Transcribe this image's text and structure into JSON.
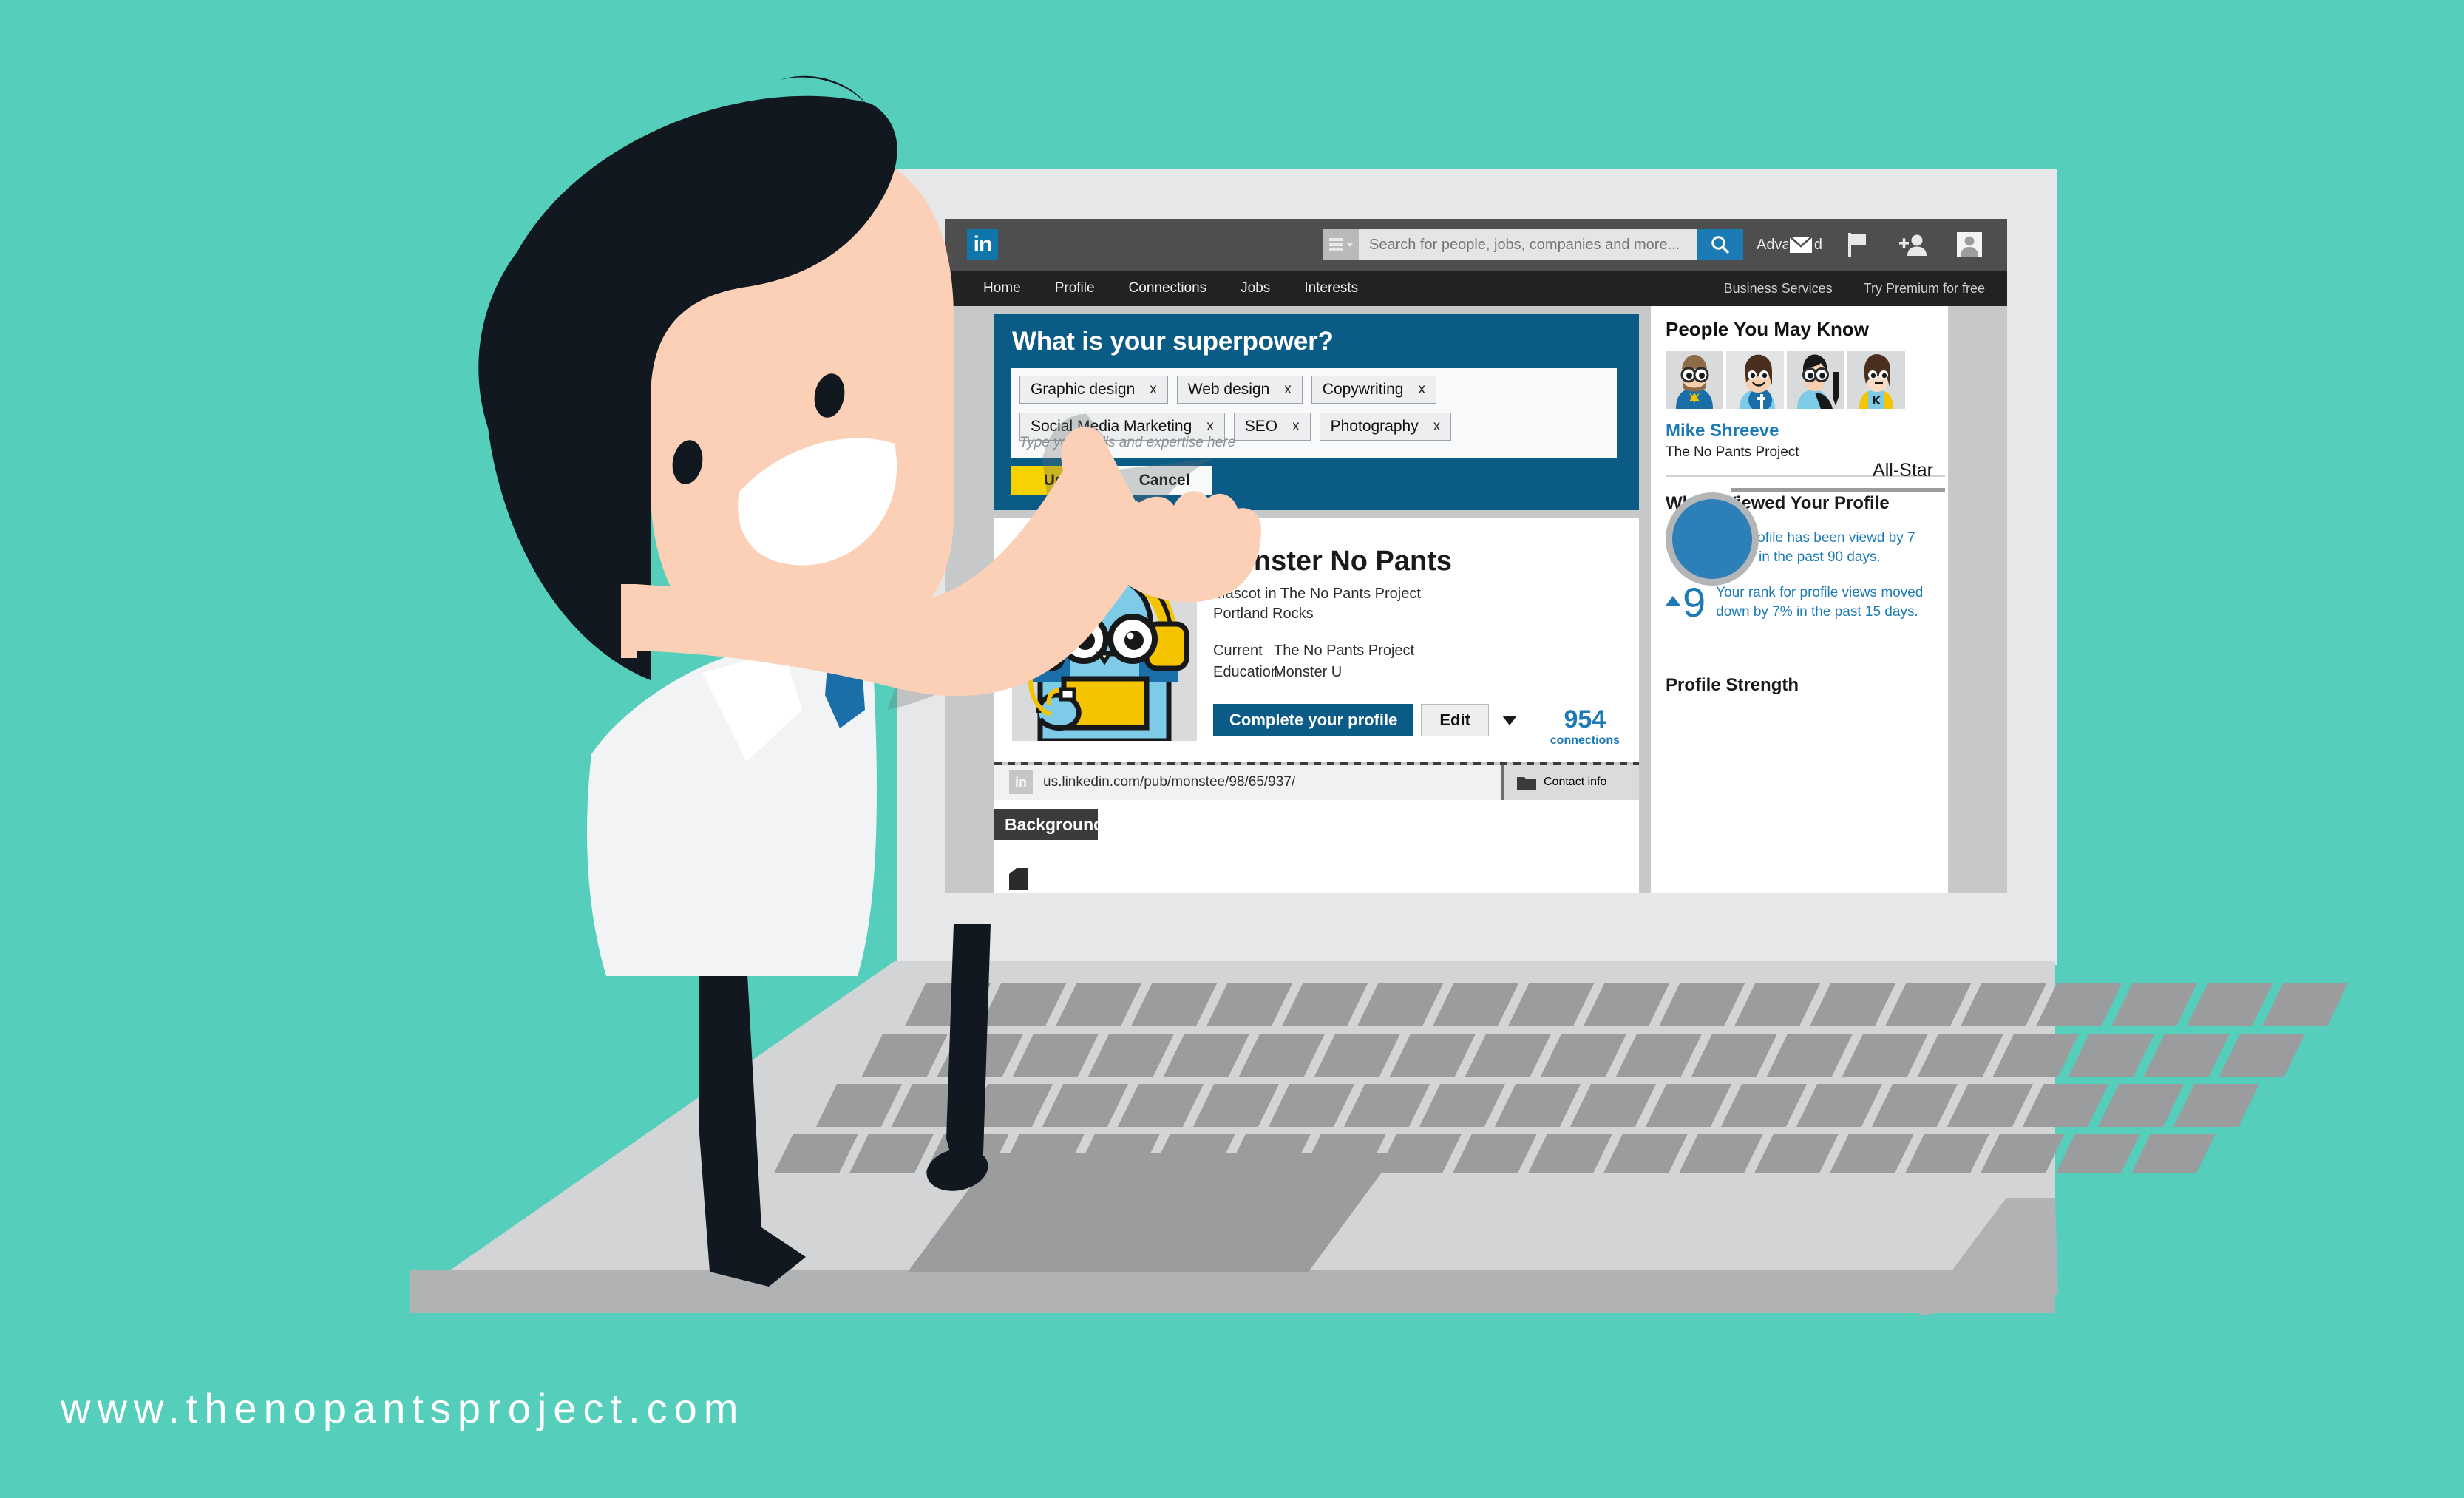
{
  "brand": {
    "teal": "#55cfbb",
    "linkedin_blue": "#0e76a8",
    "accent_blue": "#1c7ab5",
    "dialog_blue": "#0b5b87",
    "yellow": "#f5d200"
  },
  "footer": {
    "url": "www.thenopantsproject.com"
  },
  "topbar": {
    "logo_text": "in",
    "search_placeholder": "Search for people, jobs, companies and more...",
    "search_value": "",
    "search_icon": "magnifier-icon",
    "dropdown_icon": "hamburger-dropdown-icon",
    "advanced_label": "Advanced",
    "icons": [
      {
        "name": "messages-icon",
        "glyph": "envelope"
      },
      {
        "name": "notifications-icon",
        "glyph": "flag"
      },
      {
        "name": "add-connection-icon",
        "glyph": "person-plus"
      },
      {
        "name": "account-avatar-icon",
        "glyph": "avatar"
      }
    ]
  },
  "nav": {
    "primary": [
      "Home",
      "Profile",
      "Connections",
      "Jobs",
      "Interests"
    ],
    "secondary": [
      "Business Services",
      "Try Premium for free"
    ]
  },
  "superpower_dialog": {
    "title": "What is your superpower?",
    "placeholder": "Type your skills and expertise here",
    "input_value": "",
    "chips": [
      "Graphic design",
      "Web design",
      "Copywriting",
      "Social Media Marketing",
      "SEO",
      "Photography"
    ],
    "chip_remove_label": "x",
    "primary_button": "Use",
    "cancel_button": "Cancel"
  },
  "profile": {
    "name": "Monster No Pants",
    "headline": "Mascot in The No Pants Project",
    "location": "Portland Rocks",
    "meta": [
      {
        "key": "Current",
        "value": "The No Pants Project"
      },
      {
        "key": "Education",
        "value": "Monster U"
      }
    ],
    "complete_button": "Complete your profile",
    "edit_button": "Edit",
    "edit_caret_icon": "chevron-down-icon",
    "connections_count": "954",
    "connections_label": "connections",
    "public_url": "us.linkedin.com/pub/monstee/98/65/937/",
    "public_url_icon": "linkedin-small-icon",
    "contact_info_label": "Contact info",
    "contact_info_icon": "folder-icon",
    "background_tab": "Background"
  },
  "sidebar": {
    "pymk": {
      "title": "People You May Know",
      "thumbs": [
        "avatar-bearded-glasses",
        "avatar-woman-facebook",
        "avatar-man-pen",
        "avatar-woman-k"
      ],
      "person_name": "Mike Shreeve",
      "person_company": "The No Pants Project"
    },
    "who_viewed": {
      "title": "Who´s Viewed Your Profile",
      "stats": [
        {
          "number": "7",
          "arrow": false,
          "text": "Your profile has been viewd by 7 people in the past 90 days."
        },
        {
          "number": "9",
          "arrow": true,
          "text": "Your rank for profile views moved down by 7% in the past 15 days."
        }
      ]
    },
    "profile_strength": {
      "title": "Profile Strength",
      "level": "All-Star"
    }
  }
}
